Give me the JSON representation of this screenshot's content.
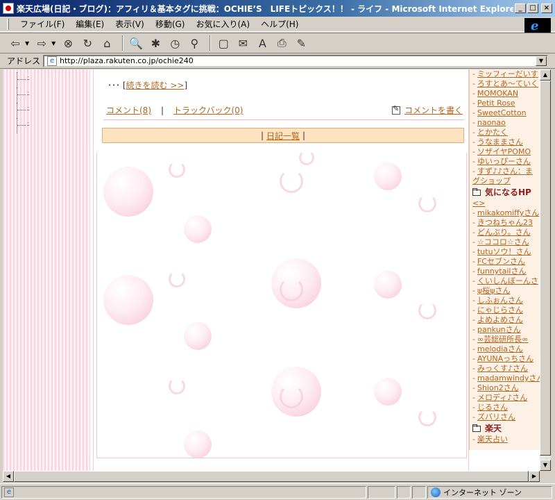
{
  "window": {
    "title": "楽天広場(日記・ブログ)：アフィリ＆基本タグに挑戦：OCHIE’S　LIFEトピックス！！ - ライフ - Microsoft Internet Explorer",
    "minimize": "_",
    "maximize": "□",
    "close": "×"
  },
  "menu": {
    "items": [
      "ファイル(F)",
      "編集(E)",
      "表示(V)",
      "移動(G)",
      "お気に入り(A)",
      "ヘルプ(H)"
    ]
  },
  "toolbar": {
    "back": "⇦",
    "forward": "⇨",
    "stop": "⊗",
    "refresh": "↻",
    "home": "⌂",
    "search": "🔍",
    "favorites": "✱",
    "history": "◷",
    "channels": "⚲",
    "fullscreen": "▢",
    "mail": "✉",
    "font": "A",
    "print": "⎙",
    "edit": "✎"
  },
  "address": {
    "label": "アドレス",
    "url": "http://plaza.rakuten.co.jp/ochie240",
    "dropdown": "▼"
  },
  "content": {
    "readmore_prefix": "･･･ [",
    "readmore_link": "続きを読む >>",
    "readmore_suffix": "]",
    "comment_link": "コメント(8)",
    "trackback_link": "トラックバック(0)",
    "separator": "|",
    "write_comment": "コメントを書く",
    "diary_list_left": "|",
    "diary_list": "日記一覧",
    "diary_list_right": "|"
  },
  "tree_items": [
    "-",
    "-",
    "-",
    "-"
  ],
  "right_column": {
    "links_top": [
      "ミッフィーだいす",
      "ろすとあ～ていく",
      "MOMOKAN",
      "Petit Rose",
      "SweetCotton",
      "naonao",
      "とかたく",
      "うなままさん",
      "ソザイヤPOMO",
      "ゆいっぴーさん",
      "すず♪♪さん：ま",
      "グショップ"
    ],
    "heading_hp": "気になるHP",
    "heading_hp_tail": "<>",
    "links_hp": [
      "mikakomiffyさん",
      "きつねちゃん23",
      "どんぶり。さん",
      "☆ココロ☆さん",
      "tutuソウ！さん",
      "FCセブンさん",
      "funnytailさん",
      "くいしんぼーんさ",
      "ψ桜ψさん",
      "しふぉんさん",
      "にゃじらさん",
      "よめよめさん",
      "pankunさん",
      "∞芸総研所長∞",
      "melodiaさん",
      "AYUNAっちさん",
      "みっくす♪さん",
      "madamwindyさん",
      "Shion2さん",
      "メロディ♪さん",
      "じるさん",
      "ズバリさん"
    ],
    "heading_rakuten": "楽天",
    "links_rakuten": [
      "楽天占い"
    ]
  },
  "scroll": {
    "up": "▲",
    "down": "▼",
    "left": "◀",
    "right": "▶"
  },
  "status": {
    "text": "",
    "zone": "インターネット ゾーン"
  }
}
